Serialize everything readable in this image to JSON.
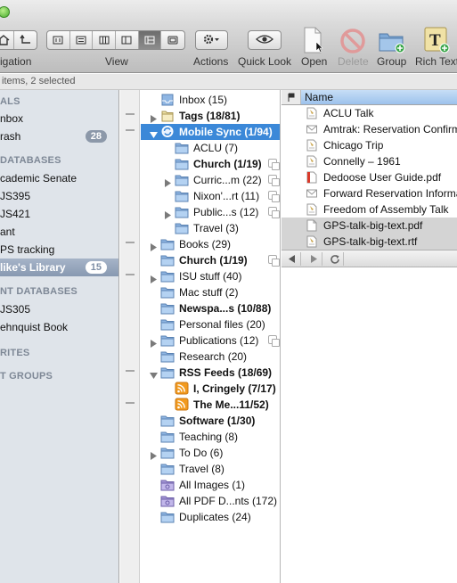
{
  "toolbar": {
    "navigation_label": "igation",
    "view_label": "View",
    "actions_label": "Actions",
    "quicklook_label": "Quick Look",
    "open_label": "Open",
    "delete_label": "Delete",
    "group_label": "Group",
    "richtext_label": "Rich Text"
  },
  "status": {
    "text": "items, 2 selected"
  },
  "sidebar": {
    "sections": [
      "ALS",
      "DATABASES",
      "NT DATABASES",
      "RITES",
      "T GROUPS"
    ],
    "items": [
      {
        "label": "nbox"
      },
      {
        "label": "rash",
        "badge": "28"
      },
      {
        "label": "cademic Senate"
      },
      {
        "label": "JS395"
      },
      {
        "label": "JS421"
      },
      {
        "label": "ant"
      },
      {
        "label": "PS tracking"
      },
      {
        "label": "like's Library",
        "badge": "15"
      },
      {
        "label": "JS305"
      },
      {
        "label": "ehnquist Book"
      }
    ]
  },
  "groups": {
    "items": [
      {
        "label": "Inbox (15)"
      },
      {
        "label": "Tags (18/81)"
      },
      {
        "label": "Mobile Sync (1/94)"
      },
      {
        "label": "ACLU (7)"
      },
      {
        "label": "Church (1/19)"
      },
      {
        "label": "Curric...m (22)"
      },
      {
        "label": "Nixon'...rt (11)"
      },
      {
        "label": "Public...s (12)"
      },
      {
        "label": "Travel (3)"
      },
      {
        "label": "Books (29)"
      },
      {
        "label": "Church (1/19)"
      },
      {
        "label": "ISU stuff (40)"
      },
      {
        "label": "Mac stuff (2)"
      },
      {
        "label": "Newspa...s (10/88)"
      },
      {
        "label": "Personal files (20)"
      },
      {
        "label": "Publications (12)"
      },
      {
        "label": "Research (20)"
      },
      {
        "label": "RSS Feeds (18/69)"
      },
      {
        "label": "I, Cringely (7/17)"
      },
      {
        "label": "The Me...11/52)"
      },
      {
        "label": "Software (1/30)"
      },
      {
        "label": "Teaching (8)"
      },
      {
        "label": "To Do (6)"
      },
      {
        "label": "Travel (8)"
      },
      {
        "label": "All Images (1)"
      },
      {
        "label": "All PDF D...nts (172)"
      },
      {
        "label": "Duplicates (24)"
      }
    ]
  },
  "list": {
    "header_name": "Name",
    "rows": [
      {
        "label": "ACLU Talk"
      },
      {
        "label": "Amtrak: Reservation Confirm"
      },
      {
        "label": "Chicago Trip"
      },
      {
        "label": "Connelly – 1961"
      },
      {
        "label": "Dedoose User Guide.pdf"
      },
      {
        "label": "Forward Reservation Informa"
      },
      {
        "label": "Freedom of Assembly Talk"
      },
      {
        "label": "GPS-talk-big-text.pdf"
      },
      {
        "label": "GPS-talk-big-text.rtf"
      }
    ]
  }
}
